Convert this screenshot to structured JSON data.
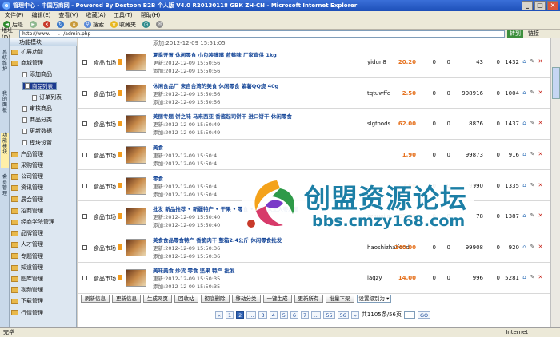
{
  "window": {
    "title": "管理中心 - 中国万商网 - Powered By Destoon B2B 个人版 V4.0 R20130118 GBK ZH-CN - Microsoft Internet Explorer"
  },
  "menu": [
    "文件(F)",
    "编辑(E)",
    "查看(V)",
    "收藏(A)",
    "工具(T)",
    "帮助(H)"
  ],
  "toolbar": {
    "back": "后退",
    "search": "搜索",
    "favorites": "收藏夹"
  },
  "address": {
    "label": "地址(D)",
    "url": "http://www.--.--.--/admin.php",
    "go": "转到",
    "links": "链接"
  },
  "sidebar": {
    "header": "功能模块",
    "vtabs": [
      "系统维护",
      "我的面板",
      "功能模块",
      "会员管理"
    ],
    "items": [
      {
        "label": "扩展功能",
        "level": 0
      },
      {
        "label": "商城管理",
        "level": 0
      },
      {
        "label": "添加商品",
        "level": 1
      },
      {
        "label": "商品列表",
        "level": 1,
        "selected": true
      },
      {
        "label": "订单列表",
        "level": 2
      },
      {
        "label": "审核商品",
        "level": 1
      },
      {
        "label": "商品分类",
        "level": 1
      },
      {
        "label": "更新数据",
        "level": 1
      },
      {
        "label": "模块设置",
        "level": 1
      },
      {
        "label": "产品管理",
        "level": 0
      },
      {
        "label": "采购管理",
        "level": 0
      },
      {
        "label": "公司管理",
        "level": 0
      },
      {
        "label": "资讯管理",
        "level": 0
      },
      {
        "label": "展会管理",
        "level": 0
      },
      {
        "label": "招商管理",
        "level": 0
      },
      {
        "label": "经商学院管理",
        "level": 0
      },
      {
        "label": "品牌管理",
        "level": 0
      },
      {
        "label": "人才管理",
        "level": 0
      },
      {
        "label": "专题管理",
        "level": 0
      },
      {
        "label": "知道管理",
        "level": 0
      },
      {
        "label": "图库管理",
        "level": 0
      },
      {
        "label": "视频管理",
        "level": 0
      },
      {
        "label": "下载管理",
        "level": 0
      },
      {
        "label": "行情管理",
        "level": 0
      }
    ]
  },
  "top_line": "添加:2012-12-09 15:51:05",
  "rows": [
    {
      "cat": "食品市场",
      "title": "夏季开胃 休闲零食 小包装嘴嘴 蓝莓味 厂家直供 1kg",
      "upd": "更新:2012-12-09 15:50:56",
      "add": "添加:2012-12-09 15:50:56",
      "user": "yidun8",
      "price": "20.20",
      "a": "0",
      "b": "0",
      "c": "43",
      "d": "0",
      "e": "1432"
    },
    {
      "cat": "食品市场",
      "title": "休闲食品厂 来自台湾的美食 休闲零食 紫薯QQ烧 40g",
      "upd": "更新:2012-12-09 15:50:56",
      "add": "添加:2012-12-09 15:50:56",
      "user": "tqtuwffd",
      "price": "2.50",
      "a": "0",
      "b": "0",
      "c": "998916",
      "d": "0",
      "e": "1004"
    },
    {
      "cat": "食品市场",
      "title": "美丽专题 饼之味 马来西亚 香酱起司饼干 进口饼干 休闲零食",
      "upd": "更新:2012-12-09 15:50:49",
      "add": "添加:2012-12-09 15:50:49",
      "user": "slgfoods",
      "price": "62.00",
      "a": "0",
      "b": "0",
      "c": "8876",
      "d": "0",
      "e": "1437"
    },
    {
      "cat": "食品市场",
      "title": "美食",
      "upd": "更新:2012-12-09 15:50:4",
      "add": "添加:2012-12-09 15:50:4",
      "user": "",
      "price": "1.90",
      "a": "0",
      "b": "0",
      "c": "99873",
      "d": "0",
      "e": "916"
    },
    {
      "cat": "食品市场",
      "title": "零食",
      "upd": "更新:2012-12-09 15:50:4",
      "add": "添加:2012-12-09 15:50:4",
      "user": "",
      "price": "2.60",
      "a": "0",
      "b": "0",
      "c": "9990",
      "d": "0",
      "e": "1335"
    },
    {
      "cat": "食品市场",
      "title": "批发 新品推荐 • 新疆特产 • 干果 • 零食 • 红枣 大王大枣六星",
      "upd": "更新:2012-12-09 15:50:40",
      "add": "添加:2012-12-09 15:50:40",
      "user": "zzguajia",
      "price": "65.00",
      "a": "0",
      "b": "0",
      "c": "78",
      "d": "0",
      "e": "1387"
    },
    {
      "cat": "食品市场",
      "title": "美食食品零食特产 香脆肉干 整箱2.4公斤 休闲零食批发",
      "upd": "更新:2012-12-09 15:50:36",
      "add": "添加:2012-12-09 15:50:36",
      "user": "haoshizhaifood",
      "price": "240.00",
      "a": "0",
      "b": "0",
      "c": "99908",
      "d": "0",
      "e": "920"
    },
    {
      "cat": "食品市场",
      "title": "美味美食 炒货 零食 坚果 特产 批发",
      "upd": "更新:2012-12-09 15:50:35",
      "add": "添加:2012-12-09 15:50:35",
      "user": "laqzy",
      "price": "14.00",
      "a": "0",
      "b": "0",
      "c": "996",
      "d": "0",
      "e": "5281"
    }
  ],
  "buttons": [
    "刷新信息",
    "更新信息",
    "生成网页",
    "回收站",
    "彻底删除",
    "移动分类",
    "一键生成",
    "更新所有",
    "批量下架"
  ],
  "select_label": "设置级别为",
  "pager": {
    "prev": "«",
    "pages": [
      "1",
      "2",
      "3",
      "4",
      "5",
      "6",
      "7"
    ],
    "dots": "...",
    "tail": [
      "55",
      "56"
    ],
    "next": "»",
    "summary": "共1105条/56页",
    "go": "GO",
    "current": "2"
  },
  "status": {
    "left": "完毕",
    "zone": "Internet"
  },
  "watermark": {
    "cn": "创盟资源论坛",
    "url": "bbs.cmzy168.com"
  }
}
